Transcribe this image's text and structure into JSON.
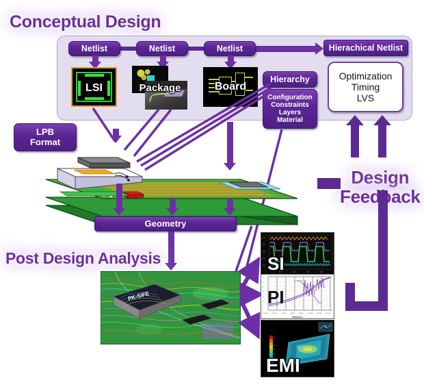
{
  "headings": {
    "conceptual_design": "Conceptual Design",
    "post_design_analysis": "Post Design Analysis",
    "design_feedback_line1": "Design",
    "design_feedback_line2": "Feedback"
  },
  "conceptual": {
    "netlist_boxes": [
      {
        "label": "Netlist"
      },
      {
        "label": "Netlist"
      },
      {
        "label": "Netlist"
      }
    ],
    "hierarchical_netlist": "Hierachical Netlist",
    "tiles": [
      {
        "name": "lsi",
        "label": "LSI"
      },
      {
        "name": "package",
        "label": "Package"
      },
      {
        "name": "board",
        "label": "Board"
      }
    ],
    "hierarchy": {
      "title": "Hierarchy",
      "items_text": "Configuration\nConstraints\nLayers\nMaterial",
      "items": [
        "Configuration",
        "Constraints",
        "Layers",
        "Material"
      ]
    },
    "optimization_box": {
      "line1": "Optimization",
      "line2": "Timing",
      "line3": "LVS"
    }
  },
  "left_boxes": {
    "lpb_format_line1": "LPB",
    "lpb_format_line2": "Format",
    "geometry": "Geometry"
  },
  "analysis": {
    "si_label": "SI",
    "pi_label": "PI",
    "emi_label": "EMI",
    "pcb_photo_chip_label": "PK-SiFE",
    "pi_axis_label": "FREQ (Hz)",
    "pi_xticks": [
      "1.E+03",
      "1.E+04",
      "1.E+05",
      "1.E+06",
      "1.E+07",
      "1.E+08",
      "1.E+09",
      "1.E+10"
    ],
    "pi_annotations": [
      "Z-Target",
      "Z-Sim"
    ]
  },
  "colors": {
    "purple_dark": "#4e1f85",
    "purple_mid": "#6b30a5",
    "purple_light": "#7b3fb0",
    "panel_bg": "#e2ddef",
    "heading_purple": "#6d2f9c",
    "lsi_border_orange": "#e8952b",
    "board_green": "#2f8f3a",
    "accent_white": "#ffffff"
  }
}
